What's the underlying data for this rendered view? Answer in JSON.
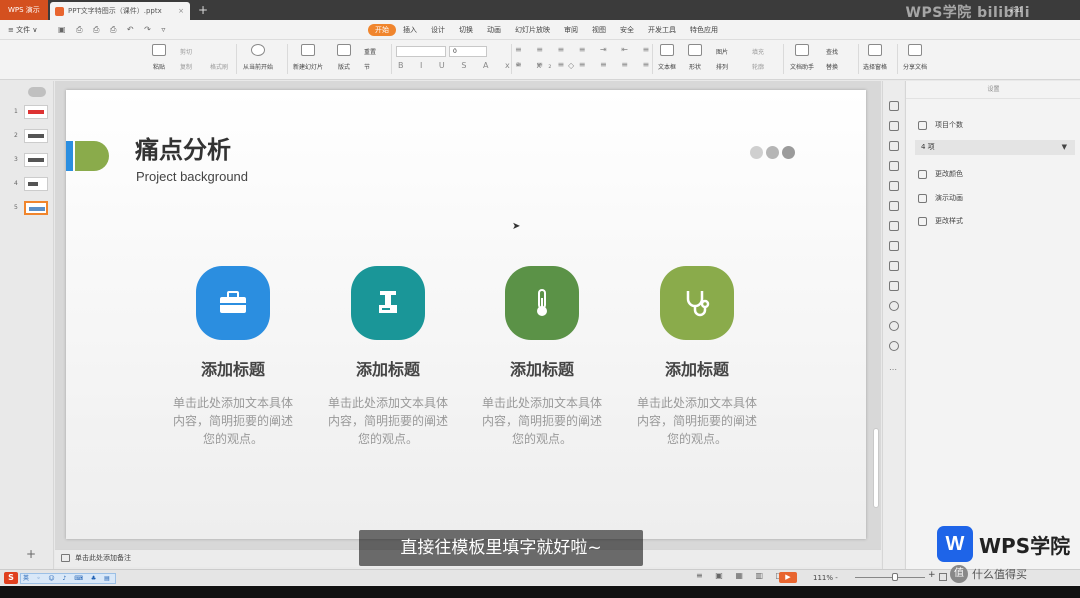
{
  "titlebar": {
    "app_tab": "WPS 演示",
    "doc_tab": "PPT文字特图示（课件）.pptx",
    "close": "×",
    "new_tab": "+",
    "watermark": "WPS学院 bilibili",
    "user": "彩虹"
  },
  "menubar": {
    "file": "≡ 文件 ∨",
    "quick_tools": "▣ ⎙ ⎙ ⎙ ↶ ↷ ▿",
    "tabs": [
      {
        "label": "开始",
        "active": true
      },
      {
        "label": "插入"
      },
      {
        "label": "设计"
      },
      {
        "label": "切换"
      },
      {
        "label": "动画"
      },
      {
        "label": "幻灯片放映"
      },
      {
        "label": "审阅"
      },
      {
        "label": "视图"
      },
      {
        "label": "安全"
      },
      {
        "label": "开发工具"
      },
      {
        "label": "特色应用"
      }
    ]
  },
  "ribbon": {
    "paste": "粘贴",
    "cut": "剪切",
    "copy": "复制",
    "format_painter": "格式刷",
    "from_current": "从当前开始",
    "new_slide": "新建幻灯片",
    "layout": "版式",
    "reset": "重置",
    "section": "节",
    "font_size": "0",
    "format_row": "B I U S A x² x₂ ◇",
    "para_row1": "≡ ≡ ≡ ≡ ⇥ ⇤ ≡",
    "para_row2": "≡ ≡ ≡ ≡ ≡ ≡ ≡",
    "textbox": "文本框",
    "shape": "形状",
    "picture": "图片",
    "arrange": "排列",
    "fill": "填充",
    "outline": "轮廓",
    "doc_assistant": "文档助手",
    "find": "查找",
    "replace": "替换",
    "select_pane": "选择窗格",
    "share_doc": "分享文档"
  },
  "thumbnails": [
    "1",
    "2",
    "3",
    "4",
    "5"
  ],
  "slide": {
    "title": "痛点分析",
    "subtitle": "Project background",
    "cards": [
      {
        "title": "添加标题",
        "body": "单击此处添加文本具体内容，简明扼要的阐述您的观点。",
        "color": "#2b8ee0",
        "icon": "briefcase-icon"
      },
      {
        "title": "添加标题",
        "body": "单击此处添加文本具体内容，简明扼要的阐述您的观点。",
        "color": "#1a9698",
        "icon": "stamp-icon"
      },
      {
        "title": "添加标题",
        "body": "单击此处添加文本具体内容，简明扼要的阐述您的观点。",
        "color": "#5b9247",
        "icon": "thermometer-icon"
      },
      {
        "title": "添加标题",
        "body": "单击此处添加文本具体内容，简明扼要的阐述您的观点。",
        "color": "#8aab4b",
        "icon": "stethoscope-icon"
      }
    ],
    "dot_colors": [
      "#cfcfcf",
      "#b5b5b5",
      "#9b9b9b"
    ],
    "accent_blue": "#2b8ee0",
    "accent_green": "#8aab4b"
  },
  "rightpane": {
    "header": "设置",
    "item_count_label": "项目个数",
    "item_count_value": "4 项",
    "change_color": "更改颜色",
    "demo_animation": "演示动画",
    "change_style": "更改样式"
  },
  "notes": {
    "placeholder": "单击此处添加备注"
  },
  "caption": "直接往模板里填字就好啦~",
  "statusbar": {
    "ime_logo": "S",
    "ime_bar": "英 ◦ ☺ ♪ ⌨ ♣ ▤",
    "views": "≡ ▣ ▦ ▥ ◫",
    "play": "▶",
    "zoom": "111% -",
    "zoom_minus": "−",
    "zoom_plus": "+"
  },
  "wps_logo": {
    "mark": "W",
    "text": "WPS学院"
  },
  "smzdm": {
    "logo": "值",
    "text": "什么值得买"
  }
}
